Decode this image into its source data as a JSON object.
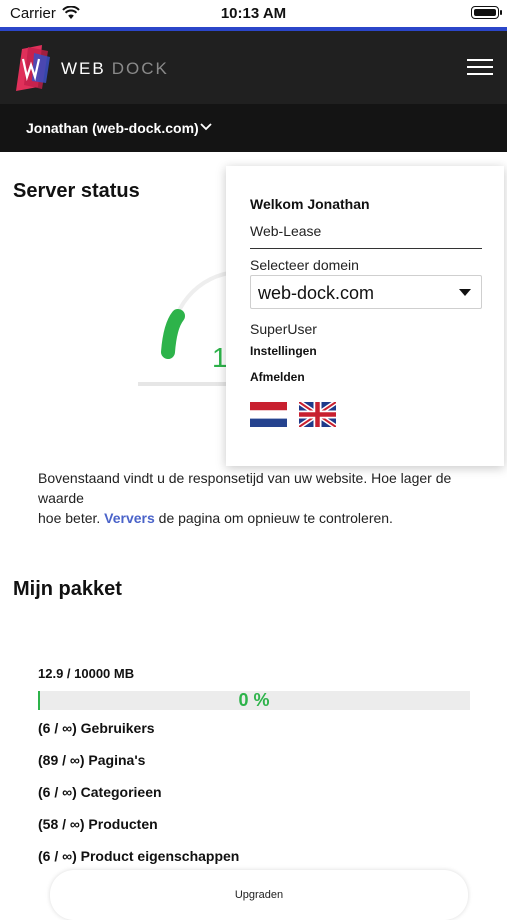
{
  "status_bar": {
    "carrier": "Carrier",
    "time": "10:13 AM"
  },
  "header": {
    "brand_primary": "WEB",
    "brand_secondary": "DOCK"
  },
  "account": {
    "label": "Jonathan (web-dock.com)"
  },
  "server_status": {
    "title": "Server status",
    "gauge_value_partial": "1",
    "description": "Bovenstaand vindt u de responsetijd van uw website. Hoe lager de waarde",
    "description_line2_before": "hoe beter. ",
    "refresh_link": "Ververs",
    "description_line2_after": " de pagina om opnieuw te controleren."
  },
  "package": {
    "title": "Mijn pakket",
    "usage": "12.9 / 10000 MB",
    "progress_label": "0 %",
    "progress_fraction": 0.0013,
    "counts": [
      "(6 / ∞) Gebruikers",
      "(89 / ∞) Pagina's",
      "(6 / ∞) Categorieen",
      "(58 / ∞) Producten",
      "(6 / ∞) Product eigenschappen"
    ],
    "upgrade_label": "Upgraden"
  },
  "dropdown": {
    "welcome": "Welkom Jonathan",
    "plan": "Web-Lease",
    "domain_label": "Selecteer domein",
    "domain_value": "web-dock.com",
    "role": "SuperUser",
    "settings": "Instellingen",
    "logout": "Afmelden"
  },
  "colors": {
    "accent_blue": "#2b46c9",
    "header_bg": "#202020",
    "success_green": "#2db34a",
    "link_blue": "#4a63c9"
  }
}
